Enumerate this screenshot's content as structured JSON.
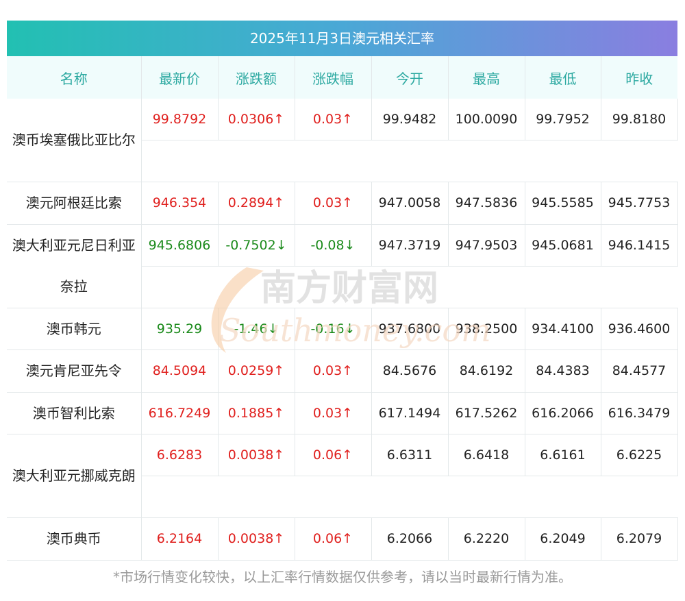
{
  "title": "2025年11月3日澳元相关汇率",
  "headers": [
    "名称",
    "最新价",
    "涨跌额",
    "涨跌幅",
    "今开",
    "最高",
    "最低",
    "昨收"
  ],
  "rows": [
    {
      "name": "澳币埃塞俄比亚比尔",
      "latest": "99.8792",
      "change": "0.0306↑",
      "pct": "0.03↑",
      "open": "99.9482",
      "high": "100.0090",
      "low": "99.7952",
      "prev": "99.8180",
      "dir": "up",
      "lines": 2
    },
    {
      "name": "澳元阿根廷比索",
      "latest": "946.354",
      "change": "0.2894↑",
      "pct": "0.03↑",
      "open": "947.0058",
      "high": "947.5836",
      "low": "945.5585",
      "prev": "945.7753",
      "dir": "up",
      "lines": 1
    },
    {
      "name": "澳大利亚元尼日利亚奈拉",
      "latest": "945.6806",
      "change": "-0.7502↓",
      "pct": "-0.08↓",
      "open": "947.3719",
      "high": "947.9503",
      "low": "945.0681",
      "prev": "946.1415",
      "dir": "down",
      "lines": 2
    },
    {
      "name": "澳币韩元",
      "latest": "935.29",
      "change": "-1.46↓",
      "pct": "-0.16↓",
      "open": "937.6800",
      "high": "938.2500",
      "low": "934.4100",
      "prev": "936.4600",
      "dir": "down",
      "lines": 1
    },
    {
      "name": "澳元肯尼亚先令",
      "latest": "84.5094",
      "change": "0.0259↑",
      "pct": "0.03↑",
      "open": "84.5676",
      "high": "84.6192",
      "low": "84.4383",
      "prev": "84.4577",
      "dir": "up",
      "lines": 1
    },
    {
      "name": "澳币智利比索",
      "latest": "616.7249",
      "change": "0.1885↑",
      "pct": "0.03↑",
      "open": "617.1494",
      "high": "617.5262",
      "low": "616.2066",
      "prev": "616.3479",
      "dir": "up",
      "lines": 1
    },
    {
      "name": "澳大利亚元挪威克朗",
      "latest": "6.6283",
      "change": "0.0038↑",
      "pct": "0.06↑",
      "open": "6.6311",
      "high": "6.6418",
      "low": "6.6161",
      "prev": "6.6225",
      "dir": "up",
      "lines": 2
    },
    {
      "name": "澳币典币",
      "latest": "6.2164",
      "change": "0.0038↑",
      "pct": "0.06↑",
      "open": "6.2066",
      "high": "6.2220",
      "low": "6.2049",
      "prev": "6.2079",
      "dir": "up",
      "lines": 1
    }
  ],
  "watermark": {
    "cn": "南方财富网",
    "en": "Southmoney.com"
  },
  "note": "*市场行情变化较快，以上汇率行情数据仅供参考，请以当时最新行情为准。"
}
